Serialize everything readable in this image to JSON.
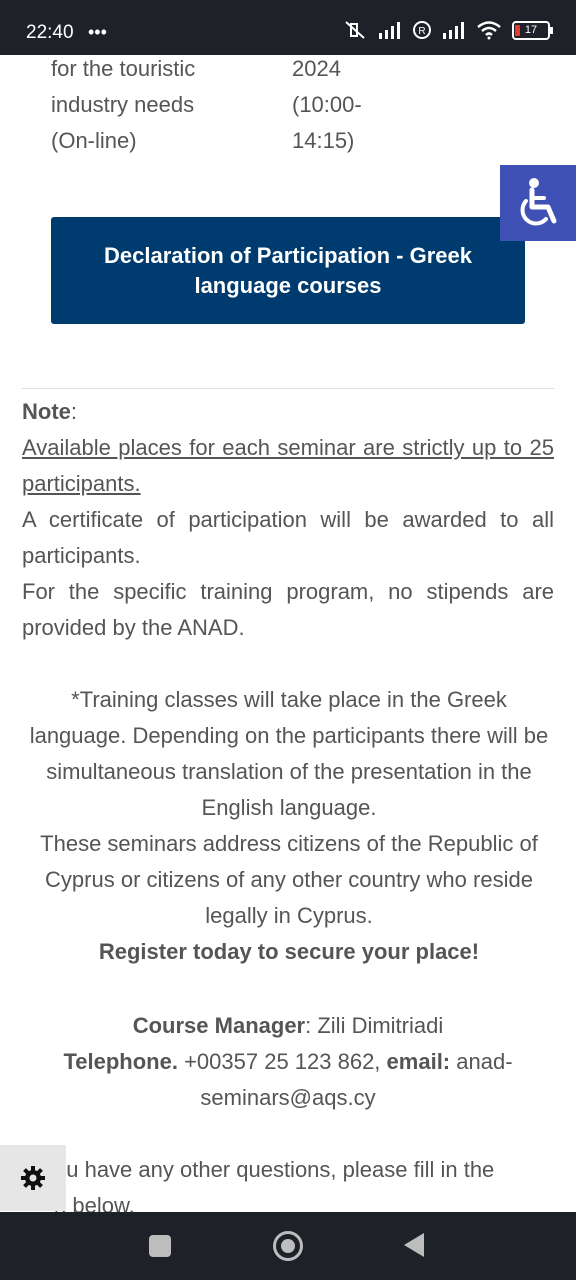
{
  "status_bar": {
    "time": "22:40",
    "left_icons": "•••",
    "battery": "17"
  },
  "course_row": {
    "title_lines": [
      "for the touristic",
      "industry needs",
      "(On-line)"
    ],
    "date_lines": [
      "2024",
      "(10:00-",
      "14:15)"
    ]
  },
  "declaration_button": "Declaration of Participation - Greek language courses",
  "note": {
    "label": "Note",
    "colon": ":",
    "underlined": "Available places for each seminar are strictly up to 25 participants.",
    "certificate": "A certificate of participation will be awarded to all participants.",
    "stipends": "For the specific training program, no stipends are provided by the ANAD."
  },
  "info": {
    "language": "*Training classes will take place in the Greek language. Depending on the participants there will be simultaneous translation of the presentation in the English language.",
    "citizens": "These seminars address citizens of the Republic of Cyprus or citizens of any other country who reside legally in Cyprus.",
    "register": "Register today to secure your place!"
  },
  "contact": {
    "manager_label": "Course Manager",
    "manager_value": ": Zili Dimitriadi",
    "phone_label": "Telephone.",
    "phone_value": " +00357 25 123 862, ",
    "email_label": "email:",
    "email_value": " anad-seminars@aqs.cy"
  },
  "footer_partial": {
    "line1": "ou have any other questions, please fill in the",
    "line2": "n below."
  },
  "icons": {
    "accessibility": "wheelchair-icon",
    "settings": "gear-icon"
  },
  "colors": {
    "button_bg": "#003b6f",
    "accessibility_bg": "#3f51b5",
    "text": "#555555"
  }
}
